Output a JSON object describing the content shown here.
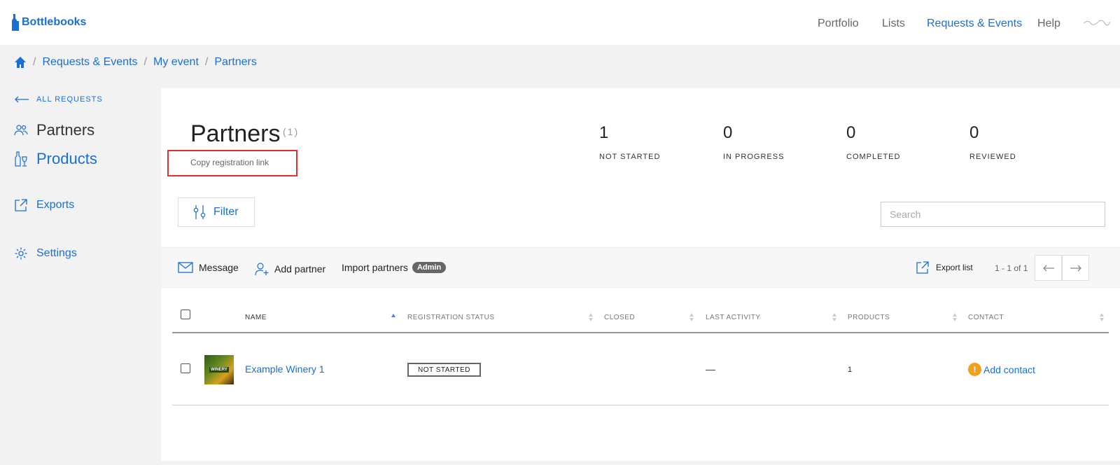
{
  "app": {
    "name": "Bottlebooks"
  },
  "nav": {
    "portfolio": "Portfolio",
    "lists": "Lists",
    "requests_events": "Requests & Events",
    "help": "Help"
  },
  "breadcrumb": [
    "Requests & Events",
    "My event",
    "Partners"
  ],
  "sidebar": {
    "back": "ALL REQUESTS",
    "partners": "Partners",
    "products": "Products",
    "exports": "Exports",
    "settings": "Settings"
  },
  "header": {
    "title": "Partners",
    "count": "(1)",
    "copy_link": "Copy registration link"
  },
  "stats": [
    {
      "value": "1",
      "label": "NOT STARTED"
    },
    {
      "value": "0",
      "label": "IN PROGRESS"
    },
    {
      "value": "0",
      "label": "COMPLETED"
    },
    {
      "value": "0",
      "label": "REVIEWED"
    }
  ],
  "filter": {
    "label": "Filter"
  },
  "search": {
    "placeholder": "Search"
  },
  "toolbar": {
    "message": "Message",
    "add_partner": "Add partner",
    "import_partners": "Import partners",
    "admin_badge": "Admin",
    "export_list": "Export list",
    "pager": "1 - 1 of 1"
  },
  "table": {
    "columns": [
      "NAME",
      "REGISTRATION STATUS",
      "CLOSED",
      "LAST ACTIVITY",
      "PRODUCTS",
      "CONTACT"
    ],
    "rows": [
      {
        "thumb_text": "WINERY",
        "name": "Example Winery 1",
        "status": "NOT STARTED",
        "last_activity": "—",
        "products": "1",
        "contact": "Add contact",
        "warn": "!"
      }
    ]
  },
  "colors": {
    "accent": "#1a6fd4",
    "warning": "#f0a020",
    "highlight": "#e03030"
  }
}
